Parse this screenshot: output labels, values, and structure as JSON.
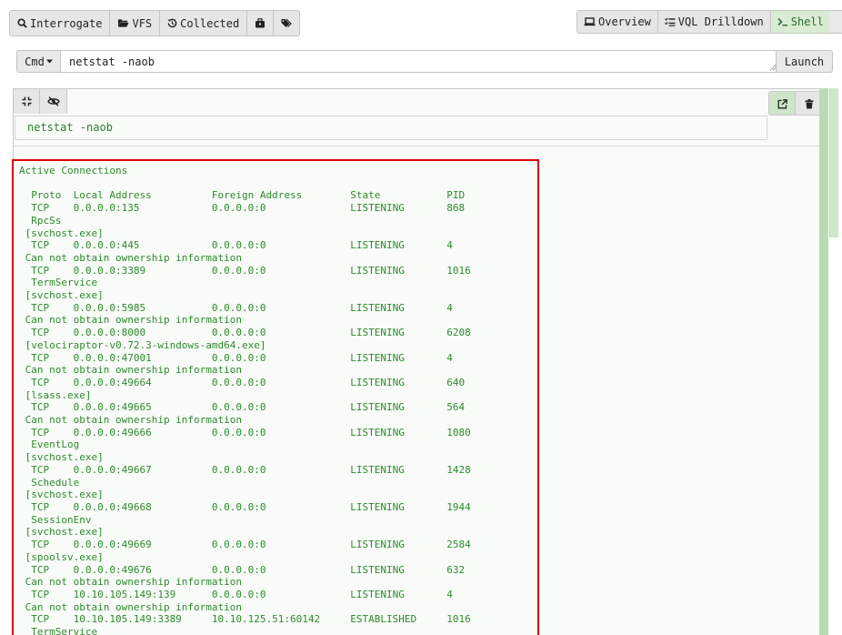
{
  "nav_left": [
    {
      "label": "Interrogate",
      "icon": "search-icon"
    },
    {
      "label": "VFS",
      "icon": "folder-open-icon"
    },
    {
      "label": "Collected",
      "icon": "history-icon"
    },
    {
      "label": "",
      "icon": "toolbox-icon"
    },
    {
      "label": "",
      "icon": "tags-icon"
    }
  ],
  "nav_right": [
    {
      "label": "Overview",
      "icon": "laptop-icon"
    },
    {
      "label": "VQL Drilldown",
      "icon": "list-check-icon"
    },
    {
      "label": "Shell",
      "icon": "terminal-icon",
      "active": true
    }
  ],
  "command": {
    "type_label": "Cmd",
    "value": "netstat -naob",
    "launch_label": "Launch"
  },
  "result": {
    "command_echo": "netstat -naob",
    "output": "Active Connections\n\n  Proto  Local Address          Foreign Address        State           PID\n  TCP    0.0.0.0:135            0.0.0.0:0              LISTENING       868\n  RpcSs\n [svchost.exe]\n  TCP    0.0.0.0:445            0.0.0.0:0              LISTENING       4\n Can not obtain ownership information\n  TCP    0.0.0.0:3389           0.0.0.0:0              LISTENING       1016\n  TermService\n [svchost.exe]\n  TCP    0.0.0.0:5985           0.0.0.0:0              LISTENING       4\n Can not obtain ownership information\n  TCP    0.0.0.0:8000           0.0.0.0:0              LISTENING       6208\n [velociraptor-v0.72.3-windows-amd64.exe]\n  TCP    0.0.0.0:47001          0.0.0.0:0              LISTENING       4\n Can not obtain ownership information\n  TCP    0.0.0.0:49664          0.0.0.0:0              LISTENING       640\n [lsass.exe]\n  TCP    0.0.0.0:49665          0.0.0.0:0              LISTENING       564\n Can not obtain ownership information\n  TCP    0.0.0.0:49666          0.0.0.0:0              LISTENING       1080\n  EventLog\n [svchost.exe]\n  TCP    0.0.0.0:49667          0.0.0.0:0              LISTENING       1428\n  Schedule\n [svchost.exe]\n  TCP    0.0.0.0:49668          0.0.0.0:0              LISTENING       1944\n  SessionEnv\n [svchost.exe]\n  TCP    0.0.0.0:49669          0.0.0.0:0              LISTENING       2584\n [spoolsv.exe]\n  TCP    0.0.0.0:49676          0.0.0.0:0              LISTENING       632\n Can not obtain ownership information\n  TCP    10.10.105.149:139      0.0.0.0:0              LISTENING       4\n Can not obtain ownership information\n  TCP    10.10.105.149:3389     10.10.125.51:60142     ESTABLISHED     1016\n  TermService"
  },
  "colors": {
    "output_text": "#2f8a2f",
    "highlight_border": "#e00000",
    "active_tab": "#d8ecd4",
    "scrollbar": "#b9dbb1"
  }
}
